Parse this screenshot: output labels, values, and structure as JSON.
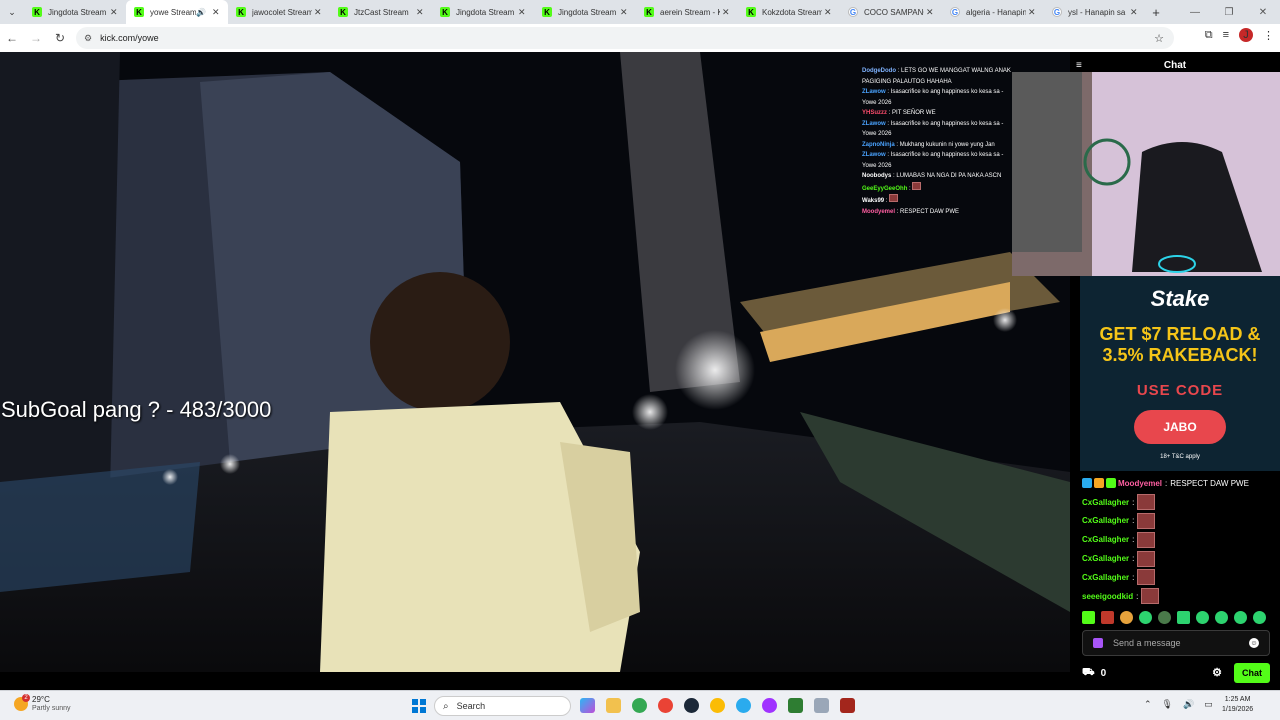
{
  "browser": {
    "tabs": [
      {
        "title": "Jingdota Stream",
        "icon": "kick",
        "active": false
      },
      {
        "title": "yowe Stream",
        "icon": "kick",
        "active": true,
        "audio": true
      },
      {
        "title": "jawocolet Stream",
        "icon": "kick",
        "active": false
      },
      {
        "title": "JtzCast Stream",
        "icon": "kick",
        "active": false
      },
      {
        "title": "Jingdota Stream",
        "icon": "kick",
        "active": false
      },
      {
        "title": "Jingdota Stream",
        "icon": "kick",
        "active": false
      },
      {
        "title": "aerein Stream - K",
        "icon": "kick",
        "active": false
      },
      {
        "title": "Kokzdota Stream",
        "icon": "kick",
        "active": false
      },
      {
        "title": "COCO SAMPANG",
        "icon": "google",
        "active": false
      },
      {
        "title": "algeria - Hanapin",
        "icon": "google",
        "active": false
      },
      {
        "title": "ysl - Hanapin sa",
        "icon": "google",
        "active": false
      }
    ],
    "url": "kick.com/yowe",
    "profile_initial": "J"
  },
  "stream": {
    "subgoal_text": "SubGoal pang ? - 483/3000",
    "overlay_chat": [
      {
        "user": "DodgeDodo",
        "text": "LETS GO WE MANGGAT WALNG ANAK PAGIGING PALAUTOG HAHAHA",
        "color": "#7fb3ff"
      },
      {
        "user": "ZLawow",
        "text": "Isasacrifice ko ang happiness ko kesa sa - Yowe 2026",
        "color": "#4aa3ff"
      },
      {
        "user": "YHSuzzz",
        "text": "PIT SEÑOR WE",
        "color": "#ff4d6d"
      },
      {
        "user": "ZLawow",
        "text": "Isasacrifice ko ang happiness ko kesa sa - Yowe 2026",
        "color": "#4aa3ff"
      },
      {
        "user": "ZapnoNinja",
        "text": "Mukhang kukunin ni yowe yung Jan",
        "color": "#4aa3ff"
      },
      {
        "user": "ZLawow",
        "text": "Isasacrifice ko ang happiness ko kesa sa - Yowe 2026",
        "color": "#4aa3ff"
      },
      {
        "user": "Noobodys",
        "text": "LUMABAS NA NGA DI PA NAKA ASCN",
        "color": "#ffffff"
      },
      {
        "user": "GeeEyyGeeOhh",
        "text": "",
        "color": "#53fc18"
      },
      {
        "user": "Waks99",
        "text": "",
        "color": "#ffffff"
      },
      {
        "user": "Moodyemel",
        "text": "RESPECT DAW PWE",
        "color": "#ff5fa2"
      }
    ]
  },
  "chat": {
    "title": "Chat",
    "messages": [
      {
        "user": "Moodyemel",
        "text": "RESPECT DAW PWE",
        "emote": false,
        "pink": true
      },
      {
        "user": "CxGallagher",
        "text": "",
        "emote": true,
        "pink": false
      },
      {
        "user": "CxGallagher",
        "text": "",
        "emote": true,
        "pink": false
      },
      {
        "user": "CxGallagher",
        "text": "",
        "emote": true,
        "pink": false
      },
      {
        "user": "CxGallagher",
        "text": "",
        "emote": true,
        "pink": false
      },
      {
        "user": "CxGallagher",
        "text": "",
        "emote": true,
        "pink": false
      },
      {
        "user": "seeeigoodkid",
        "text": "",
        "emote": true,
        "pink": false
      }
    ],
    "input_placeholder": "Send a message",
    "points": "0",
    "send_label": "Chat"
  },
  "ad": {
    "brand": "Stake",
    "promo_line1": "GET $7 RELOAD &",
    "promo_line2": "3.5% RAKEBACK!",
    "use_code": "USE CODE",
    "code": "JABO",
    "terms": "18+   T&C apply"
  },
  "taskbar": {
    "temperature": "29°C",
    "weather": "Partly sunny",
    "weather_badge": "2",
    "search_label": "Search",
    "time": "1:25 AM",
    "date": "1/19/2026"
  },
  "colors": {
    "kick_green": "#53fc18",
    "stake_red": "#e8474d",
    "stake_yellow": "#f5c518"
  }
}
